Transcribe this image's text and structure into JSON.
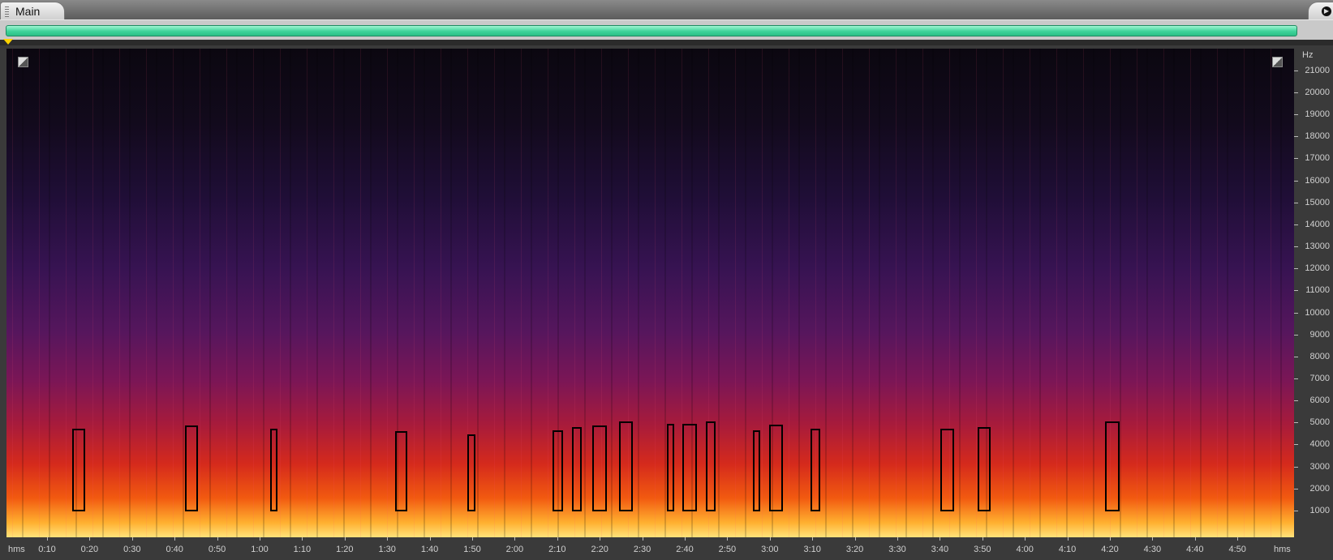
{
  "tab": {
    "title": "Main"
  },
  "colors": {
    "overview_bar": "#3fd49a",
    "marker_outline": "#000000",
    "cursor": "#ffd400"
  },
  "icons": [
    "grip-icon",
    "tab-menu-arrow-icon",
    "playback-cursor-icon",
    "zoom-corner-icon"
  ],
  "axes": {
    "frequency": {
      "unit_label": "Hz",
      "ticks": [
        "21000",
        "20000",
        "19000",
        "18000",
        "17000",
        "16000",
        "15000",
        "14000",
        "13000",
        "12000",
        "11000",
        "10000",
        "9000",
        "8000",
        "7000",
        "6000",
        "5000",
        "4000",
        "3000",
        "2000",
        "1000"
      ]
    },
    "time": {
      "unit_label": "hms",
      "ticks": [
        "0:10",
        "0:20",
        "0:30",
        "0:40",
        "0:50",
        "1:00",
        "1:10",
        "1:20",
        "1:30",
        "1:40",
        "1:50",
        "2:00",
        "2:10",
        "2:20",
        "2:30",
        "2:40",
        "2:50",
        "3:00",
        "3:10",
        "3:20",
        "3:30",
        "3:40",
        "3:50",
        "4:00",
        "4:10",
        "4:20",
        "4:30",
        "4:40",
        "4:50"
      ]
    }
  },
  "marked_regions": [
    {
      "start_s": 16.0,
      "end_s": 19.0,
      "top_hz": 4700
    },
    {
      "start_s": 42.4,
      "end_s": 45.5,
      "top_hz": 4850
    },
    {
      "start_s": 62.5,
      "end_s": 64.2,
      "top_hz": 4700
    },
    {
      "start_s": 91.8,
      "end_s": 94.8,
      "top_hz": 4600
    },
    {
      "start_s": 108.8,
      "end_s": 110.8,
      "top_hz": 4450
    },
    {
      "start_s": 128.8,
      "end_s": 131.4,
      "top_hz": 4650
    },
    {
      "start_s": 133.4,
      "end_s": 135.8,
      "top_hz": 4800
    },
    {
      "start_s": 138.2,
      "end_s": 141.6,
      "top_hz": 4850
    },
    {
      "start_s": 144.6,
      "end_s": 147.8,
      "top_hz": 5050
    },
    {
      "start_s": 155.8,
      "end_s": 157.6,
      "top_hz": 4950
    },
    {
      "start_s": 159.4,
      "end_s": 162.8,
      "top_hz": 4950
    },
    {
      "start_s": 165.0,
      "end_s": 167.2,
      "top_hz": 5050
    },
    {
      "start_s": 176.0,
      "end_s": 177.8,
      "top_hz": 4650
    },
    {
      "start_s": 179.8,
      "end_s": 183.0,
      "top_hz": 4900
    },
    {
      "start_s": 189.6,
      "end_s": 191.8,
      "top_hz": 4700
    },
    {
      "start_s": 220.2,
      "end_s": 223.4,
      "top_hz": 4700
    },
    {
      "start_s": 228.8,
      "end_s": 232.0,
      "top_hz": 4800
    },
    {
      "start_s": 258.8,
      "end_s": 262.2,
      "top_hz": 5050
    }
  ]
}
